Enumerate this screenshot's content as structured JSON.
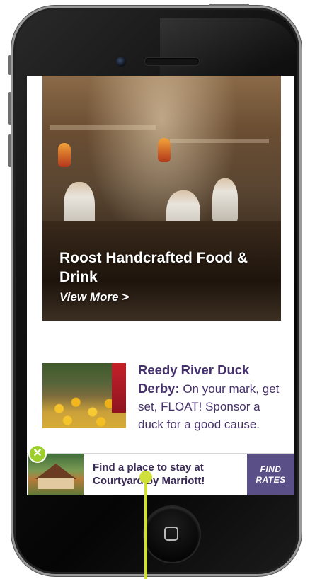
{
  "hero": {
    "title": "Roost Handcrafted Food & Drink",
    "link": "View More >"
  },
  "story": {
    "headline": "Reedy River Duck Derby:",
    "body": " On your mark, get set, FLOAT! Sponsor a duck for a good cause."
  },
  "ad": {
    "text": "Find a place to stay at Courtyard by Marriott!",
    "cta": "FIND RATES",
    "close": "✕"
  },
  "colors": {
    "accent_purple": "#5a4f86",
    "story_text": "#45316b",
    "close_green": "#9ccf2a",
    "pointer": "#cfe03a"
  }
}
